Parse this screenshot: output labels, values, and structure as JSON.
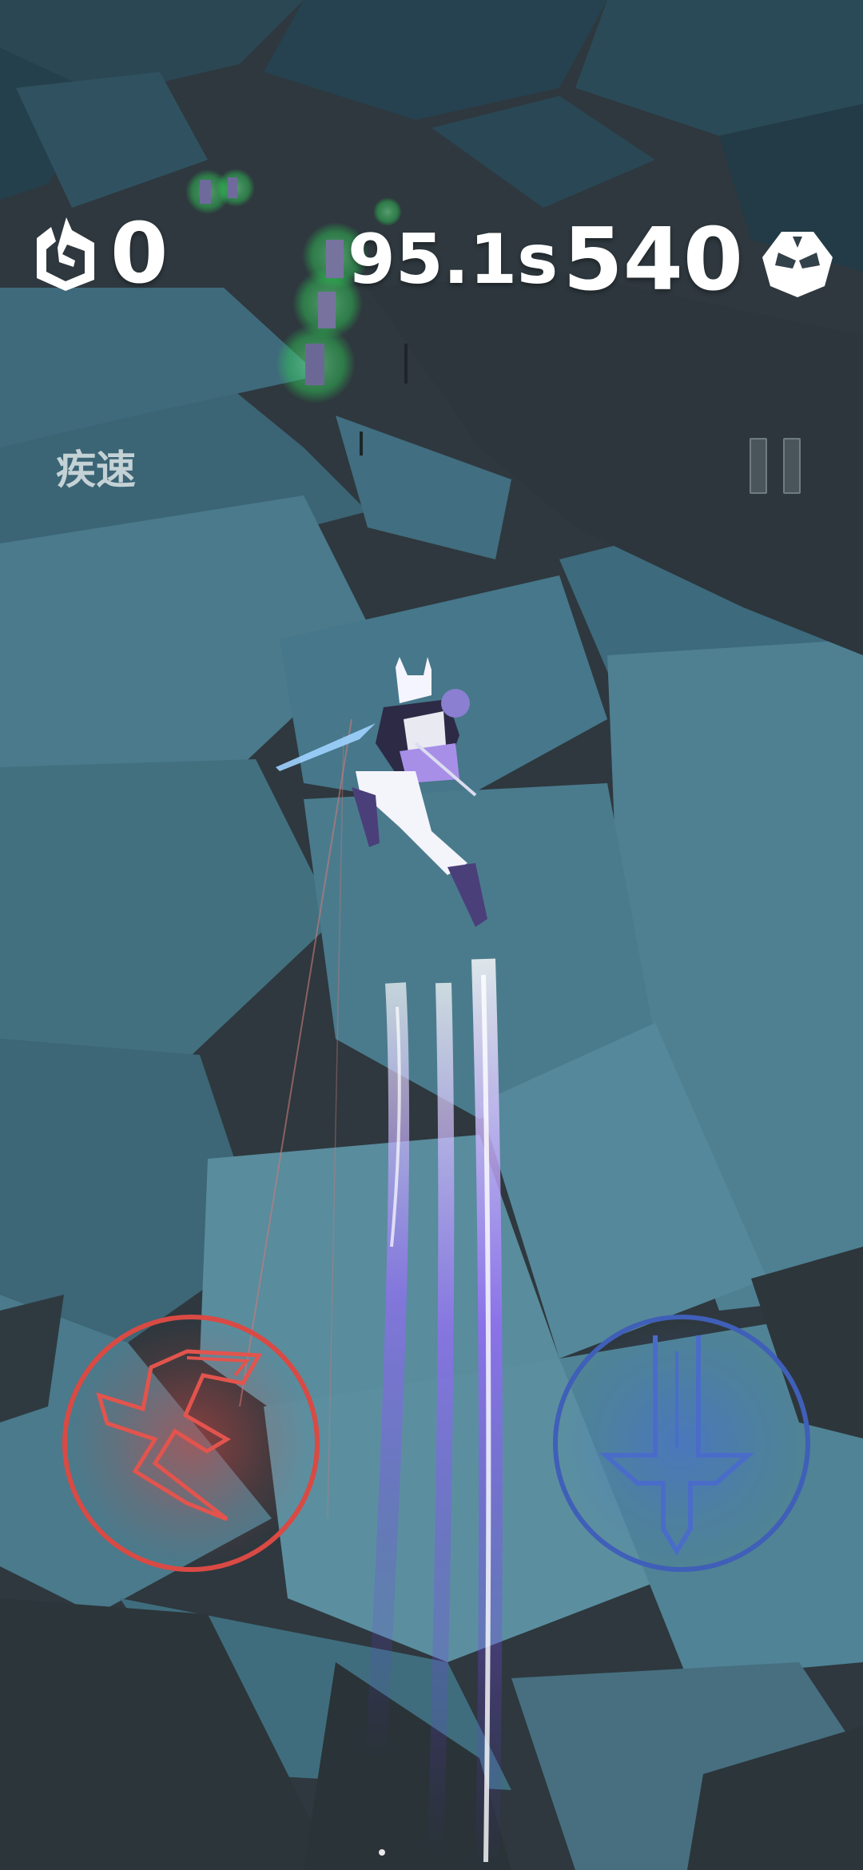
{
  "hud": {
    "combo_count": "0",
    "timer": "95.1s",
    "score": "540",
    "mode_label": "疾速"
  },
  "icons": {
    "combo": "spiral-shard-icon",
    "score": "mask-icon",
    "pause": "pause-icon",
    "dash": "dash-rune-icon",
    "strike": "sword-icon"
  },
  "colors": {
    "dash_accent": "#d94a44",
    "strike_accent": "#3f5fb8",
    "trail": "#8a5cff",
    "enemy_glow": "#3ddc5a",
    "hud_text": "#ffffff"
  }
}
